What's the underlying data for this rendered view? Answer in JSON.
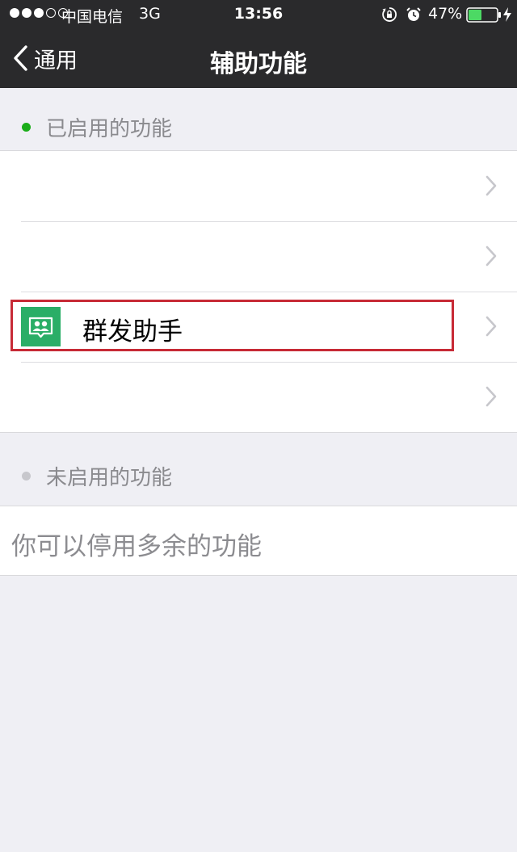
{
  "status_bar": {
    "carrier": "中国电信",
    "network": "3G",
    "time": "13:56",
    "battery": "47%",
    "battery_level": 0.47,
    "signal_dots_filled": 3,
    "signal_dots_total": 5,
    "icons": [
      "orientation-lock-icon",
      "alarm-icon",
      "battery-icon",
      "charging-icon"
    ]
  },
  "nav": {
    "back_label": "通用",
    "title": "辅助功能"
  },
  "enabled_section": {
    "title": "已启用的功能",
    "indicator_color": "#1aad19",
    "items": [
      {
        "label": ""
      },
      {
        "label": ""
      },
      {
        "label": "群发助手",
        "icon": "group-chat-icon",
        "icon_color": "#2aae67",
        "highlighted": true
      },
      {
        "label": ""
      }
    ]
  },
  "disabled_section": {
    "title": "未启用的功能",
    "indicator_color": "#c7c7cc",
    "hint": "你可以停用多余的功能"
  },
  "colors": {
    "nav_background": "#2a2a2c",
    "page_background": "#efeff4",
    "highlight_border": "#c72a36"
  }
}
